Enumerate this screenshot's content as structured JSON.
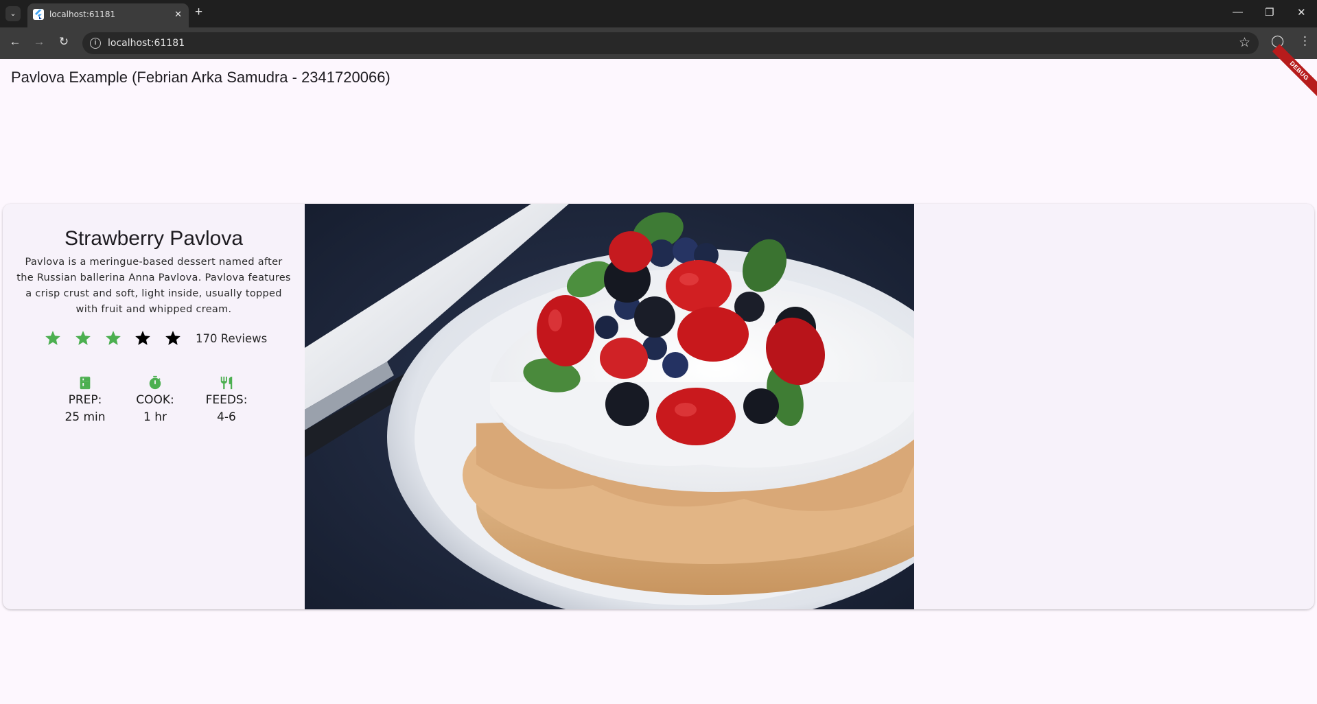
{
  "browser": {
    "tab_title": "localhost:61181",
    "url": "localhost:61181",
    "tab_close": "✕",
    "new_tab": "+",
    "tab_search": "⌄",
    "controls": {
      "minimize": "—",
      "restore": "❐",
      "close": "✕"
    },
    "nav": {
      "back": "←",
      "forward": "→",
      "reload": "↻"
    },
    "bookmark": "☆",
    "profile": "◯",
    "menu": "⋮",
    "site_info": "i"
  },
  "app": {
    "appbar_title": "Pavlova Example (Febrian Arka Samudra - 2341720066)",
    "debug_banner": "DEBUG"
  },
  "recipe": {
    "title": "Strawberry Pavlova",
    "description": "Pavlova is a meringue-based dessert named after the Russian ballerina Anna Pavlova. Pavlova features a crisp crust and soft, light inside, usually topped with fruit and whipped cream.",
    "rating": {
      "stars_total": 5,
      "stars_filled_green": 3,
      "reviews_text": "170 Reviews",
      "green": "#4caf50",
      "black": "#000000"
    },
    "info": [
      {
        "icon": "kitchen-icon",
        "label": "PREP:",
        "value": "25 min"
      },
      {
        "icon": "timer-icon",
        "label": "COOK:",
        "value": "1 hr"
      },
      {
        "icon": "restaurant-icon",
        "label": "FEEDS:",
        "value": "4-6"
      }
    ],
    "image_alt": "Pavlova topped with strawberries, blueberries and blackberries"
  },
  "colors": {
    "accent": "#4caf50",
    "page_bg": "#fdf7fe",
    "card_bg": "#f7f2fa"
  }
}
